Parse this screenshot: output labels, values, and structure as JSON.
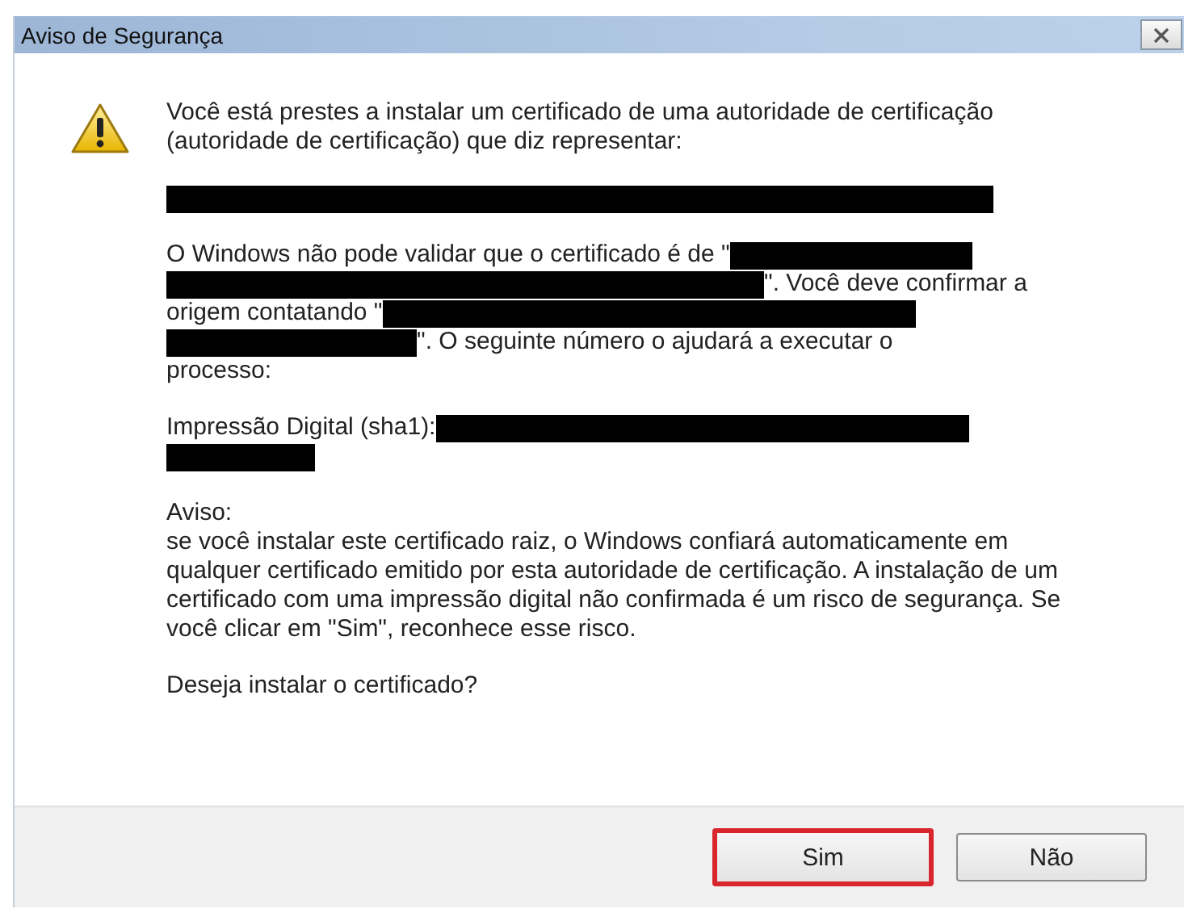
{
  "window": {
    "title": "Aviso de Segurança"
  },
  "intro": "Você está prestes a instalar um certificado de uma autoridade de certificação (autoridade de certificação) que diz representar:",
  "subject_lines": [
    [
      {
        "kind": "redaction"
      }
    ]
  ],
  "validation_lines": [
    [
      {
        "kind": "text",
        "text": "O Windows não pode validar que o certificado é de \""
      },
      {
        "kind": "redaction"
      }
    ],
    [
      {
        "kind": "redaction"
      },
      {
        "kind": "text",
        "text": "\". Você deve confirmar a"
      }
    ],
    [
      {
        "kind": "text",
        "text": "origem contatando \""
      },
      {
        "kind": "redaction"
      }
    ],
    [
      {
        "kind": "redaction"
      },
      {
        "kind": "text",
        "text": "\". O seguinte número o ajudará a executar o"
      }
    ],
    [
      {
        "kind": "text",
        "text": "processo:"
      }
    ]
  ],
  "thumbprint_lines": [
    [
      {
        "kind": "text",
        "text": "Impressão Digital (sha1):"
      },
      {
        "kind": "redaction"
      }
    ],
    [
      {
        "kind": "redaction"
      }
    ]
  ],
  "warning": {
    "heading": "Aviso:",
    "text": "se você instalar este certificado raiz, o Windows confiará automaticamente em qualquer certificado emitido por esta autoridade de certificação. A instalação de um certificado com uma impressão digital não confirmada é um risco de segurança. Se você clicar em \"Sim\", reconhece esse risco."
  },
  "question": "Deseja instalar o certificado?",
  "buttons": [
    {
      "label": "Sim",
      "highlighted": true
    },
    {
      "label": "Não",
      "highlighted": false
    }
  ]
}
